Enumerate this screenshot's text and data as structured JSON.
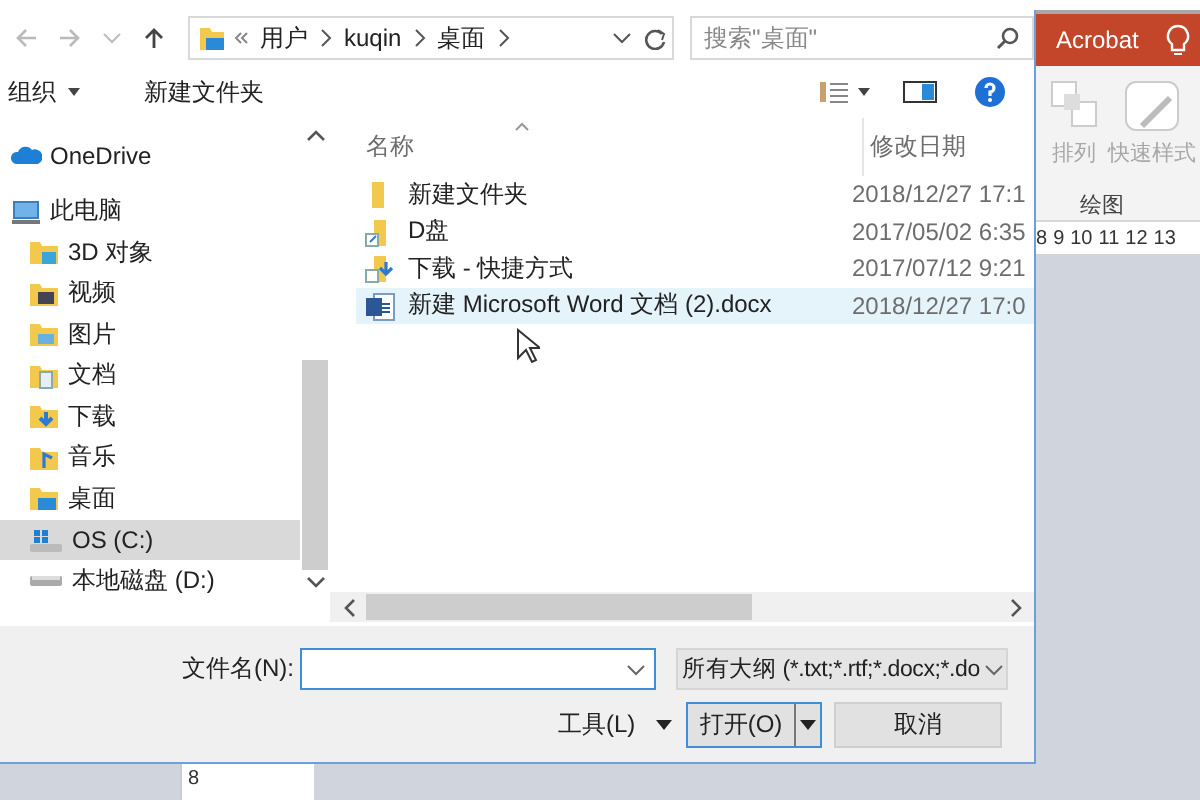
{
  "background_app": {
    "tab": "Acrobat",
    "ribbon_buttons": [
      "排列",
      "快速样式"
    ],
    "group_label": "绘图",
    "ruler": [
      "8",
      "9",
      "10",
      "11",
      "12",
      "13"
    ],
    "page_ruler": "8"
  },
  "dialog": {
    "nav": {
      "path": [
        "用户",
        "kuqin",
        "桌面"
      ],
      "search_placeholder": "搜索\"桌面\""
    },
    "toolbar": {
      "organize": "组织",
      "new_folder": "新建文件夹"
    },
    "sidebar": [
      {
        "label": "OneDrive",
        "kind": "cloud",
        "selected": false
      },
      {
        "label": "此电脑",
        "kind": "pc",
        "selected": false,
        "children": [
          {
            "label": "3D 对象",
            "kind": "objects",
            "selected": false
          },
          {
            "label": "视频",
            "kind": "video",
            "selected": false
          },
          {
            "label": "图片",
            "kind": "pictures",
            "selected": false
          },
          {
            "label": "文档",
            "kind": "documents",
            "selected": false
          },
          {
            "label": "下载",
            "kind": "downloads",
            "selected": false
          },
          {
            "label": "音乐",
            "kind": "music",
            "selected": false
          },
          {
            "label": "桌面",
            "kind": "desktop",
            "selected": false
          },
          {
            "label": "OS (C:)",
            "kind": "system-drive",
            "selected": true
          },
          {
            "label": "本地磁盘 (D:)",
            "kind": "drive",
            "selected": false
          }
        ]
      }
    ],
    "files": {
      "columns": [
        "名称",
        "修改日期"
      ],
      "rows": [
        {
          "name": "新建文件夹",
          "date": "2018/12/27 17:1",
          "kind": "folder",
          "highlighted": false
        },
        {
          "name": "D盘",
          "date": "2017/05/02 6:35",
          "kind": "shortcut",
          "highlighted": false
        },
        {
          "name": "下载 - 快捷方式",
          "date": "2017/07/12 9:21",
          "kind": "download-shortcut",
          "highlighted": false
        },
        {
          "name": "新建 Microsoft Word 文档 (2).docx",
          "date": "2018/12/27 17:0",
          "kind": "docx",
          "highlighted": true
        }
      ]
    },
    "filename_label": "文件名(N):",
    "filter": "所有大纲 (*.txt;*.rtf;*.docx;*.do",
    "tools": "工具(L)",
    "open": "打开(O)",
    "cancel": "取消"
  }
}
